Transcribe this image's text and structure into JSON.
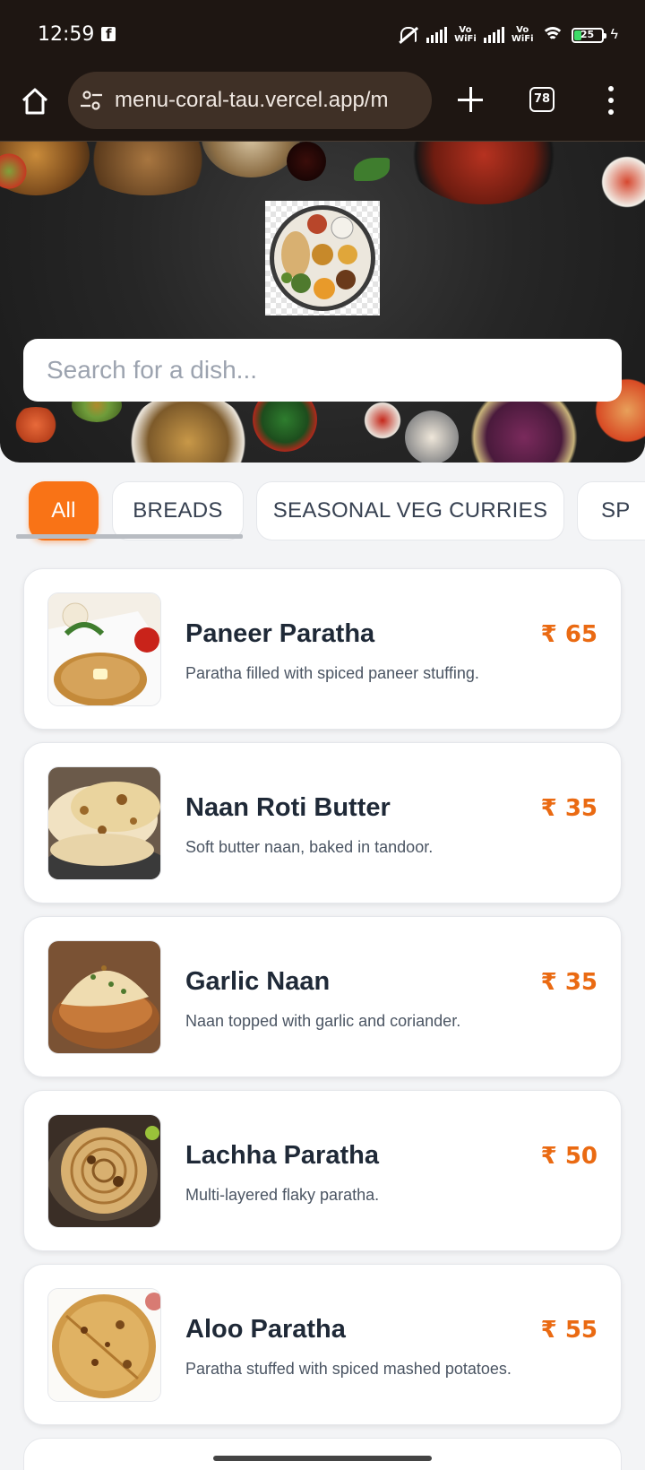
{
  "status_bar": {
    "time": "12:59",
    "vowifi_label_1": "Vo\nWiFi",
    "vowifi_label_2": "Vo\nWiFi",
    "battery_level": "25",
    "battery_fraction": 0.25,
    "battery_color": "#3ddc68"
  },
  "browser": {
    "url": "menu-coral-tau.vercel.app/m",
    "tab_count": "78"
  },
  "hero": {
    "search_placeholder": "Search for a dish..."
  },
  "categories": [
    {
      "label": "All",
      "active": true
    },
    {
      "label": "BREADS",
      "active": false
    },
    {
      "label": "SEASONAL VEG CURRIES",
      "active": false
    },
    {
      "label": "SP",
      "active": false
    }
  ],
  "menu_items": [
    {
      "name": "Paneer Paratha",
      "description": "Paratha filled with spiced paneer stuffing.",
      "price": "₹ 65"
    },
    {
      "name": "Naan Roti Butter",
      "description": "Soft butter naan, baked in tandoor.",
      "price": "₹ 35"
    },
    {
      "name": "Garlic Naan",
      "description": "Naan topped with garlic and coriander.",
      "price": "₹ 35"
    },
    {
      "name": "Lachha Paratha",
      "description": "Multi-layered flaky paratha.",
      "price": "₹ 50"
    },
    {
      "name": "Aloo Paratha",
      "description": "Paratha stuffed with spiced mashed potatoes.",
      "price": "₹ 55"
    }
  ],
  "colors": {
    "accent": "#f97316",
    "price": "#ea6a12",
    "browser_bg": "#1e1612"
  },
  "icons": [
    "home-icon",
    "site-settings-icon",
    "new-tab-plus-icon",
    "tab-switcher-icon",
    "more-menu-icon",
    "mute-icon",
    "signal-icon",
    "wifi-icon",
    "battery-icon",
    "facebook-icon",
    "charging-bolt-icon"
  ]
}
